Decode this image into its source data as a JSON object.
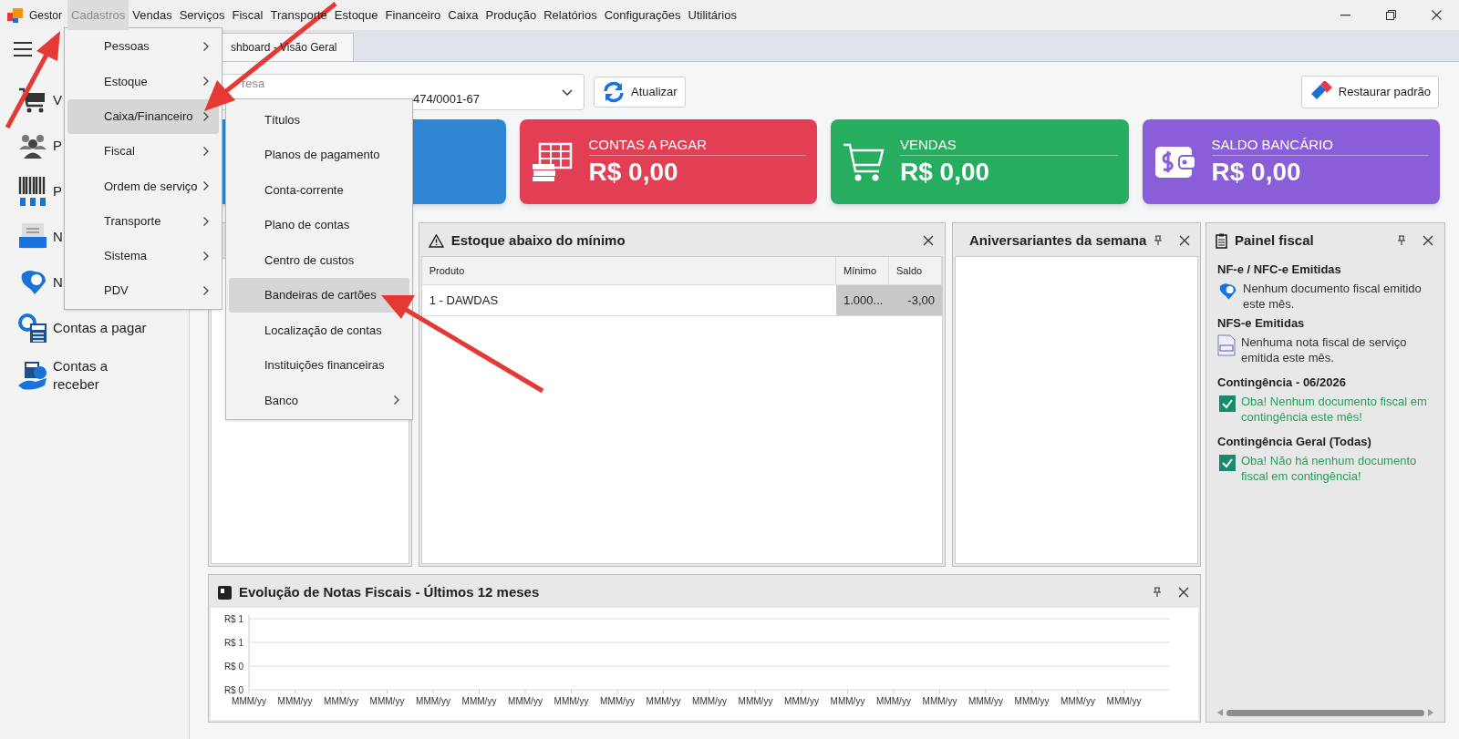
{
  "menu_bar": {
    "app": "Gestor",
    "items": [
      {
        "label": "Cadastros",
        "selected": true
      },
      {
        "label": "Vendas",
        "selected": false
      },
      {
        "label": "Serviços",
        "selected": false
      },
      {
        "label": "Fiscal",
        "selected": false
      },
      {
        "label": "Transporte",
        "selected": false
      },
      {
        "label": "Estoque",
        "selected": false
      },
      {
        "label": "Financeiro",
        "selected": false
      },
      {
        "label": "Caixa",
        "selected": false
      },
      {
        "label": "Produção",
        "selected": false
      },
      {
        "label": "Relatórios",
        "selected": false
      },
      {
        "label": "Configurações",
        "selected": false
      },
      {
        "label": "Utilitários",
        "selected": false
      }
    ]
  },
  "sidebar": {
    "items": [
      {
        "kind": "cart",
        "label": "V"
      },
      {
        "kind": "people",
        "label": "P"
      },
      {
        "kind": "barcode",
        "label": "P"
      },
      {
        "kind": "nfse",
        "label": "N"
      },
      {
        "kind": "nfe",
        "label": "N"
      },
      {
        "kind": "payable",
        "label": "Contas a pagar"
      },
      {
        "kind": "receivable",
        "label": "Contas a receber"
      }
    ]
  },
  "tab": {
    "label": "shboard - Visão Geral"
  },
  "company_select": {
    "placeholder": "resa",
    "value": "474/0001-67"
  },
  "refresh_button": "Atualizar",
  "restore_button": "Restaurar padrão",
  "cards": [
    {
      "color": "#2f86d2"
    },
    {
      "kind": "table",
      "title": "CONTAS A PAGAR",
      "value": "R$ 0,00",
      "color": "#e23e54"
    },
    {
      "kind": "cart",
      "title": "VENDAS",
      "value": "R$ 0,00",
      "color": "#27ad5f"
    },
    {
      "kind": "wallet",
      "title": "SALDO BANCÁRIO",
      "value": "R$ 0,00",
      "color": "#8a5ed8"
    }
  ],
  "stock_panel": {
    "title": "Estoque abaixo do mínimo",
    "columns": [
      "Produto",
      "Mínimo",
      "Saldo"
    ],
    "rows": [
      [
        "1 - DAWDAS",
        "1.000...",
        "-3,00"
      ]
    ]
  },
  "birthdays_panel": {
    "title": "Aniversariantes da semana"
  },
  "fiscal_panel": {
    "title": "Painel fiscal",
    "sections": [
      {
        "heading": "NF-e / NFC-e Emitidas",
        "kind": "nfe",
        "text": "Nenhum documento fiscal emitido este mês."
      },
      {
        "heading": "NFS-e Emitidas",
        "kind": "nfse",
        "text": "Nenhuma nota fiscal de serviço emitida este mês."
      },
      {
        "heading": "Contingência - 06/2026",
        "kind": "ok",
        "text": "Oba! Nenhum documento fiscal em contingência este mês!"
      },
      {
        "heading": "Contingência Geral (Todas)",
        "kind": "ok",
        "text": "Oba! Não há nenhum documento fiscal em contingência!"
      }
    ]
  },
  "chart_panel": {
    "title": "Evolução de Notas Fiscais - Últimos 12 meses",
    "y_labels": [
      "R$ 1",
      "R$ 1",
      "R$ 0",
      "R$ 0"
    ],
    "x_labels": [
      "MMM/yy",
      "MMM/yy",
      "MMM/yy",
      "MMM/yy",
      "MMM/yy",
      "MMM/yy",
      "MMM/yy",
      "MMM/yy",
      "MMM/yy",
      "MMM/yy",
      "MMM/yy",
      "MMM/yy",
      "MMM/yy",
      "MMM/yy",
      "MMM/yy",
      "MMM/yy",
      "MMM/yy",
      "MMM/yy",
      "MMM/yy",
      "MMM/yy"
    ]
  },
  "cadastros_menu": {
    "items": [
      {
        "label": "Pessoas",
        "selected": false,
        "has_submenu": true
      },
      {
        "label": "Estoque",
        "selected": false,
        "has_submenu": true
      },
      {
        "label": "Caixa/Financeiro",
        "selected": true,
        "has_submenu": true
      },
      {
        "label": "Fiscal",
        "selected": false,
        "has_submenu": true
      },
      {
        "label": "Ordem de serviço",
        "selected": false,
        "has_submenu": true
      },
      {
        "label": "Transporte",
        "selected": false,
        "has_submenu": true
      },
      {
        "label": "Sistema",
        "selected": false,
        "has_submenu": true
      },
      {
        "label": "PDV",
        "selected": false,
        "has_submenu": true
      }
    ]
  },
  "submenu": {
    "items": [
      {
        "label": "Títulos",
        "selected": false,
        "has_submenu": false
      },
      {
        "label": "Planos de pagamento",
        "selected": false,
        "has_submenu": false
      },
      {
        "label": "Conta-corrente",
        "selected": false,
        "has_submenu": false
      },
      {
        "label": "Plano de contas",
        "selected": false,
        "has_submenu": false
      },
      {
        "label": "Centro de custos",
        "selected": false,
        "has_submenu": false
      },
      {
        "label": "Bandeiras de cartões",
        "selected": true,
        "has_submenu": false
      },
      {
        "label": "Localização de contas",
        "selected": false,
        "has_submenu": false
      },
      {
        "label": "Instituições financeiras",
        "selected": false,
        "has_submenu": false
      },
      {
        "label": "Banco",
        "selected": false,
        "has_submenu": true
      }
    ]
  }
}
